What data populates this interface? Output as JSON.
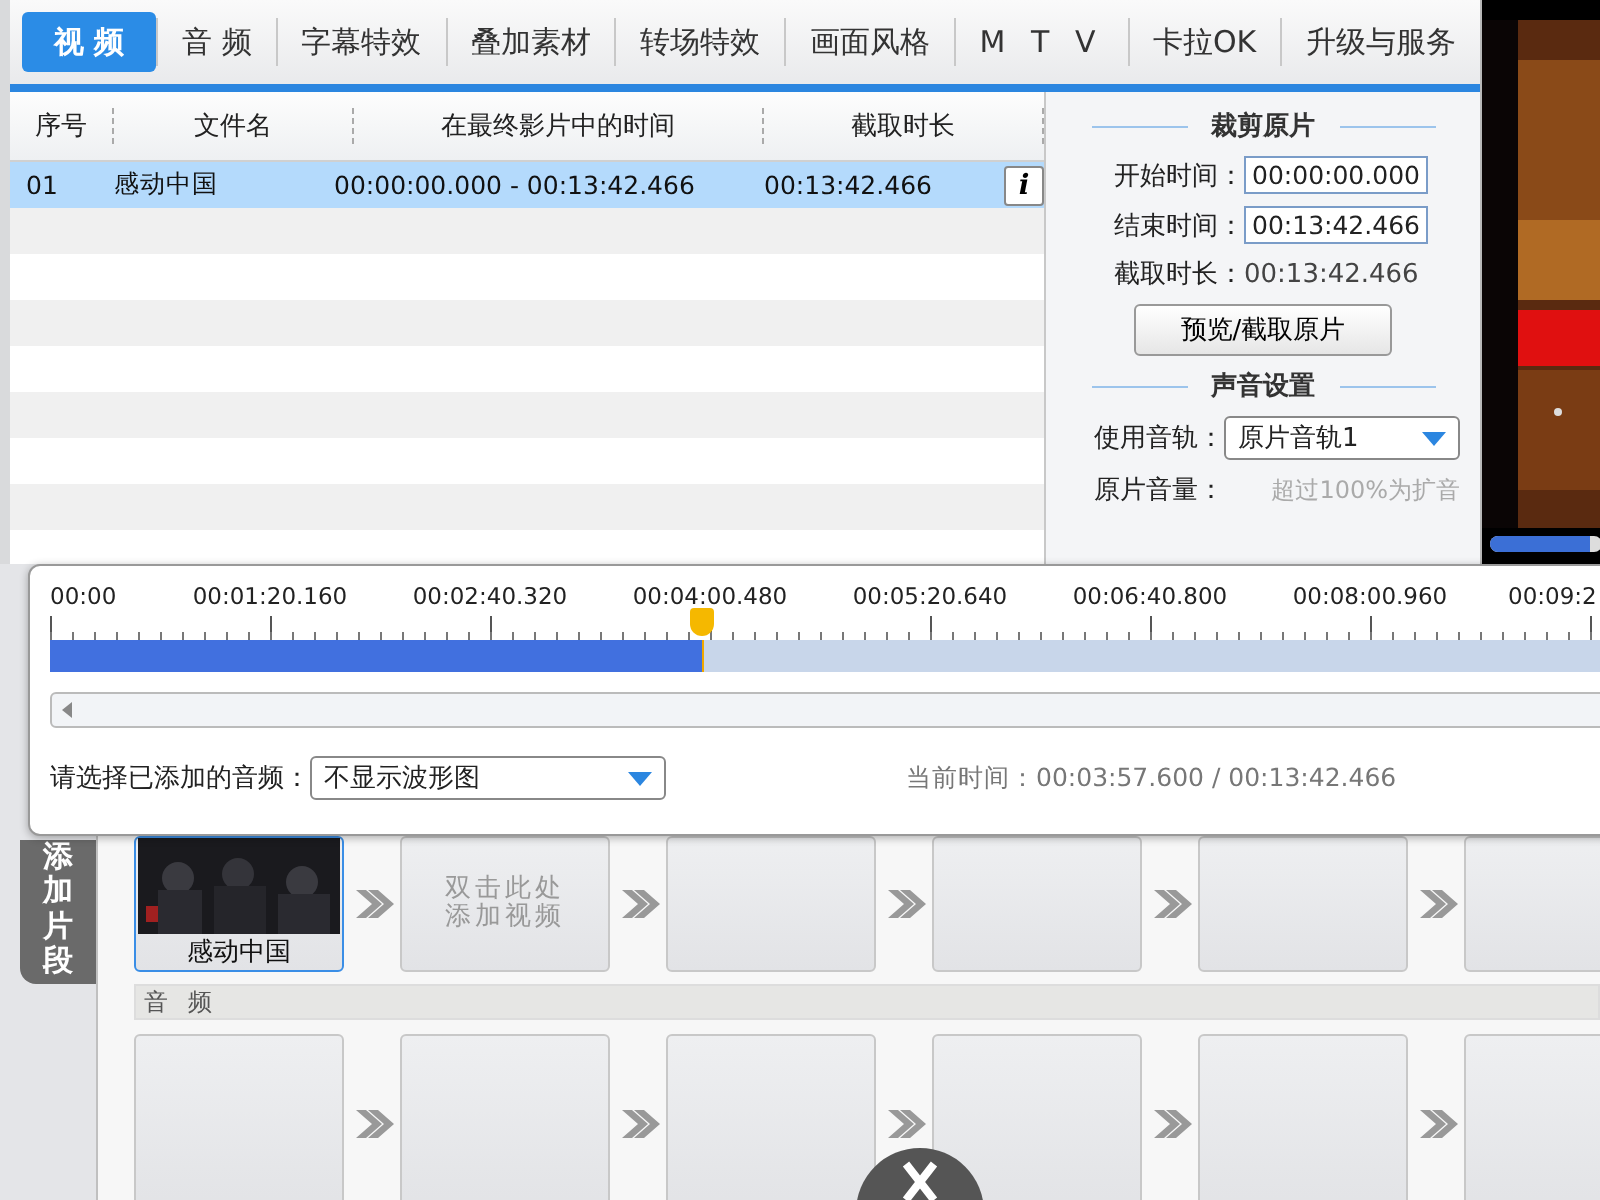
{
  "tabs": [
    {
      "label": "视 频",
      "selected": true
    },
    {
      "label": "音 频",
      "selected": false
    },
    {
      "label": "字幕特效",
      "selected": false
    },
    {
      "label": "叠加素材",
      "selected": false
    },
    {
      "label": "转场特效",
      "selected": false
    },
    {
      "label": "画面风格",
      "selected": false
    },
    {
      "label": "M T V",
      "selected": false
    },
    {
      "label": "卡拉OK",
      "selected": false
    },
    {
      "label": "升级与服务",
      "selected": false
    }
  ],
  "table": {
    "columns": [
      "序号",
      "文件名",
      "在最终影片中的时间",
      "截取时长"
    ],
    "rows": [
      {
        "cells": [
          "01",
          "感动中国",
          "00:00:00.000 - 00:13:42.466",
          "00:13:42.466"
        ],
        "info": "i",
        "selected": true
      }
    ]
  },
  "trim_panel": {
    "title": "裁剪原片",
    "fields": [
      {
        "label": "开始时间：",
        "value": "00:00:00.000"
      },
      {
        "label": "结束时间：",
        "value": "00:13:42.466"
      }
    ],
    "duration": {
      "label": "截取时长：",
      "value": "00:13:42.466"
    },
    "button": "预览/截取原片"
  },
  "sound_panel": {
    "title": "声音设置",
    "track": {
      "label": "使用音轨：",
      "value": "原片音轨1"
    },
    "volume": {
      "label": "原片音量：",
      "hint": "超过100%为扩音"
    }
  },
  "preview": {
    "kind": "picture",
    "level": 0.9
  },
  "timeline": {
    "ticks": [
      "00:00",
      "00:01:20.160",
      "00:02:40.320",
      "00:04:00.480",
      "00:05:20.640",
      "00:06:40.800",
      "00:08:00.960",
      "00:09:2"
    ],
    "level": 0.289,
    "audio_select": {
      "label": "请选择已添加的音频：",
      "value": "不显示波形图"
    },
    "current_time": {
      "label": "当前时间：",
      "value": "00:03:57.600 / 00:13:42.466"
    }
  },
  "side_tab": "添加片段",
  "video_track": [
    {
      "kind": "clip",
      "label": "感动中国",
      "selected": true
    },
    {
      "kind": "placeholder",
      "lines": [
        "双击此处",
        "添加视频"
      ],
      "selected": false
    },
    {
      "kind": "empty",
      "selected": false
    },
    {
      "kind": "empty",
      "selected": false
    },
    {
      "kind": "empty",
      "selected": false
    },
    {
      "kind": "empty",
      "selected": false
    }
  ],
  "audio_label": "音 频",
  "audio_track": [
    {
      "kind": "empty"
    },
    {
      "kind": "empty"
    },
    {
      "kind": "empty"
    },
    {
      "kind": "empty"
    },
    {
      "kind": "empty"
    },
    {
      "kind": "empty"
    }
  ]
}
